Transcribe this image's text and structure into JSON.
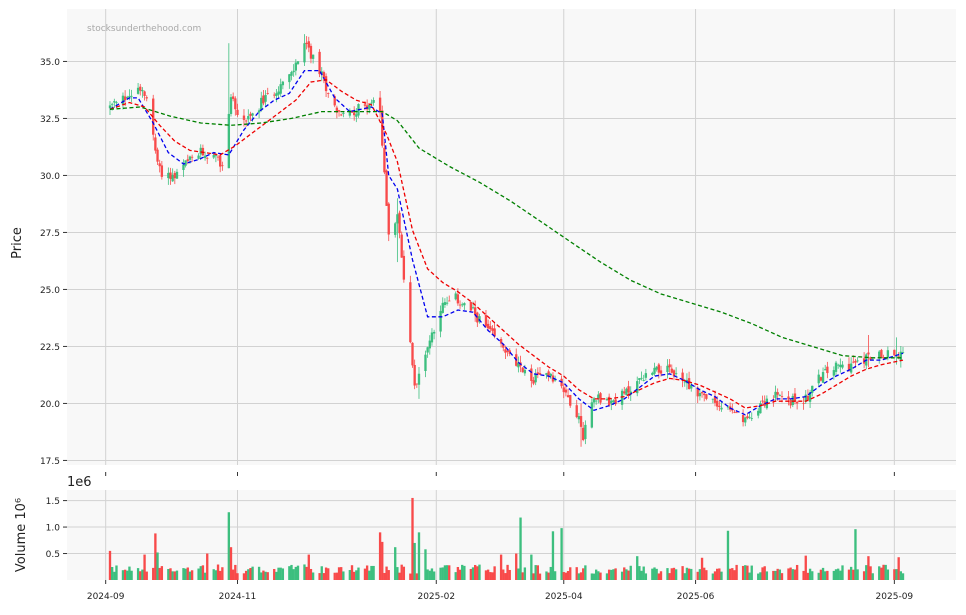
{
  "watermark": "stocksunderthehood.com",
  "colors": {
    "up": "#3dbf7f",
    "down": "#f84a4a",
    "ma_blue": "#0000ee",
    "ma_red": "#ee0000",
    "ma_green": "#008000",
    "panel_bg": "#f8f8f8",
    "grid": "#d2d2d2"
  },
  "chart_data": {
    "type": "candlestick",
    "price_panel": {
      "ylabel": "Price",
      "ylim": [
        17.3,
        37.3
      ],
      "yticks": [
        "17.5",
        "20.0",
        "22.5",
        "25.0",
        "27.5",
        "30.0",
        "32.5",
        "35.0"
      ],
      "grid": true
    },
    "volume_panel": {
      "ylabel": "Volume  10⁶",
      "multiplier_label": "1e6",
      "ylim": [
        0,
        1.7
      ],
      "yticks": [
        "0.5",
        "1.0",
        "1.5"
      ],
      "grid": true
    },
    "xticks": [
      "2024-09",
      "2024-11",
      "2025-02",
      "2025-04",
      "2025-06",
      "2025-09"
    ],
    "x_range": [
      "2024-09-03",
      "2025-09-05"
    ],
    "close_path": [
      [
        "2024-09-03",
        33.0
      ],
      [
        "2024-09-10",
        33.4
      ],
      [
        "2024-09-17",
        33.9
      ],
      [
        "2024-09-20",
        33.6
      ],
      [
        "2024-09-24",
        31.0
      ],
      [
        "2024-09-26",
        30.2
      ],
      [
        "2024-10-03",
        29.9
      ],
      [
        "2024-10-08",
        30.5
      ],
      [
        "2024-10-15",
        31.0
      ],
      [
        "2024-10-21",
        30.8
      ],
      [
        "2024-10-25",
        30.4
      ],
      [
        "2024-10-29",
        33.6
      ],
      [
        "2024-11-01",
        32.6
      ],
      [
        "2024-11-06",
        32.4
      ],
      [
        "2024-11-12",
        33.2
      ],
      [
        "2024-11-19",
        33.8
      ],
      [
        "2024-11-26",
        34.4
      ],
      [
        "2024-12-02",
        35.8
      ],
      [
        "2024-12-09",
        34.6
      ],
      [
        "2024-12-16",
        33.0
      ],
      [
        "2024-12-20",
        32.6
      ],
      [
        "2025-01-02",
        33.2
      ],
      [
        "2025-01-06",
        32.8
      ],
      [
        "2025-01-10",
        27.5
      ],
      [
        "2025-01-14",
        28.2
      ],
      [
        "2025-01-22",
        20.8
      ],
      [
        "2025-01-28",
        22.5
      ],
      [
        "2025-02-03",
        24.2
      ],
      [
        "2025-02-10",
        24.6
      ],
      [
        "2025-02-18",
        24.0
      ],
      [
        "2025-02-25",
        23.2
      ],
      [
        "2025-03-04",
        22.4
      ],
      [
        "2025-03-11",
        21.6
      ],
      [
        "2025-03-18",
        21.0
      ],
      [
        "2025-03-25",
        21.4
      ],
      [
        "2025-04-01",
        20.6
      ],
      [
        "2025-04-07",
        19.6
      ],
      [
        "2025-04-10",
        18.6
      ],
      [
        "2025-04-15",
        20.4
      ],
      [
        "2025-04-22",
        20.0
      ],
      [
        "2025-04-29",
        20.4
      ],
      [
        "2025-05-06",
        21.0
      ],
      [
        "2025-05-13",
        21.6
      ],
      [
        "2025-05-20",
        21.4
      ],
      [
        "2025-05-27",
        21.0
      ],
      [
        "2025-06-03",
        20.4
      ],
      [
        "2025-06-10",
        20.0
      ],
      [
        "2025-06-17",
        19.6
      ],
      [
        "2025-06-24",
        19.2
      ],
      [
        "2025-07-01",
        20.0
      ],
      [
        "2025-07-08",
        20.3
      ],
      [
        "2025-07-15",
        20.1
      ],
      [
        "2025-07-22",
        20.2
      ],
      [
        "2025-07-29",
        21.2
      ],
      [
        "2025-08-05",
        21.6
      ],
      [
        "2025-08-12",
        21.7
      ],
      [
        "2025-08-19",
        22.0
      ],
      [
        "2025-08-26",
        22.2
      ],
      [
        "2025-09-05",
        22.1
      ]
    ],
    "spikes": [
      {
        "date": "2024-10-28",
        "high": 35.8,
        "low": 33.0
      },
      {
        "date": "2024-12-02",
        "high": 36.2,
        "low": 34.8
      },
      {
        "date": "2025-01-14",
        "high": 29.0,
        "low": 26.2
      },
      {
        "date": "2025-01-24",
        "high": 21.6,
        "low": 20.2
      },
      {
        "date": "2025-04-09",
        "high": 20.0,
        "low": 18.1
      },
      {
        "date": "2025-08-20",
        "high": 23.0,
        "low": 21.6
      },
      {
        "date": "2025-09-02",
        "high": 22.9,
        "low": 21.7
      }
    ],
    "series": [
      {
        "name": "",
        "style": "dashed",
        "color": "#0000ee",
        "points": [
          [
            "2024-09-03",
            32.9
          ],
          [
            "2024-09-12",
            33.4
          ],
          [
            "2024-09-16",
            33.4
          ],
          [
            "2024-09-23",
            32.3
          ],
          [
            "2024-09-30",
            31.0
          ],
          [
            "2024-10-07",
            30.5
          ],
          [
            "2024-10-14",
            30.7
          ],
          [
            "2024-10-21",
            31.0
          ],
          [
            "2024-10-28",
            30.9
          ],
          [
            "2024-11-04",
            32.0
          ],
          [
            "2024-11-11",
            32.8
          ],
          [
            "2024-11-18",
            33.3
          ],
          [
            "2024-11-25",
            33.6
          ],
          [
            "2024-12-02",
            34.6
          ],
          [
            "2024-12-09",
            34.6
          ],
          [
            "2024-12-16",
            33.4
          ],
          [
            "2024-12-23",
            32.8
          ],
          [
            "2025-01-02",
            33.0
          ],
          [
            "2025-01-07",
            32.7
          ],
          [
            "2025-01-10",
            30.0
          ],
          [
            "2025-01-14",
            29.4
          ],
          [
            "2025-01-21",
            26.3
          ],
          [
            "2025-01-28",
            23.8
          ],
          [
            "2025-02-04",
            23.8
          ],
          [
            "2025-02-11",
            24.1
          ],
          [
            "2025-02-18",
            24.0
          ],
          [
            "2025-02-25",
            23.2
          ],
          [
            "2025-03-04",
            22.6
          ],
          [
            "2025-03-11",
            21.8
          ],
          [
            "2025-03-18",
            21.3
          ],
          [
            "2025-03-25",
            21.2
          ],
          [
            "2025-04-01",
            20.9
          ],
          [
            "2025-04-08",
            20.2
          ],
          [
            "2025-04-15",
            19.7
          ],
          [
            "2025-04-22",
            19.9
          ],
          [
            "2025-04-29",
            20.2
          ],
          [
            "2025-05-06",
            20.7
          ],
          [
            "2025-05-13",
            21.2
          ],
          [
            "2025-05-20",
            21.3
          ],
          [
            "2025-05-27",
            21.0
          ],
          [
            "2025-06-03",
            20.6
          ],
          [
            "2025-06-10",
            20.3
          ],
          [
            "2025-06-17",
            19.8
          ],
          [
            "2025-06-24",
            19.5
          ],
          [
            "2025-07-01",
            19.9
          ],
          [
            "2025-07-08",
            20.2
          ],
          [
            "2025-07-15",
            20.2
          ],
          [
            "2025-07-22",
            20.3
          ],
          [
            "2025-07-29",
            20.8
          ],
          [
            "2025-08-05",
            21.2
          ],
          [
            "2025-08-12",
            21.5
          ],
          [
            "2025-08-19",
            21.9
          ],
          [
            "2025-08-26",
            21.9
          ],
          [
            "2025-09-05",
            22.2
          ]
        ]
      },
      {
        "name": "",
        "style": "dashed",
        "color": "#ee0000",
        "points": [
          [
            "2024-09-03",
            32.9
          ],
          [
            "2024-09-12",
            33.2
          ],
          [
            "2024-09-19",
            33.0
          ],
          [
            "2024-09-26",
            32.2
          ],
          [
            "2024-10-03",
            31.5
          ],
          [
            "2024-10-10",
            31.1
          ],
          [
            "2024-10-17",
            31.0
          ],
          [
            "2024-10-24",
            30.9
          ],
          [
            "2024-10-31",
            31.3
          ],
          [
            "2024-11-07",
            31.8
          ],
          [
            "2024-11-14",
            32.3
          ],
          [
            "2024-11-21",
            32.8
          ],
          [
            "2024-11-28",
            33.3
          ],
          [
            "2024-12-05",
            34.1
          ],
          [
            "2024-12-12",
            34.2
          ],
          [
            "2024-12-19",
            33.7
          ],
          [
            "2024-12-26",
            33.3
          ],
          [
            "2025-01-02",
            33.1
          ],
          [
            "2025-01-09",
            31.8
          ],
          [
            "2025-01-14",
            30.6
          ],
          [
            "2025-01-21",
            27.6
          ],
          [
            "2025-01-28",
            25.9
          ],
          [
            "2025-02-04",
            25.3
          ],
          [
            "2025-02-11",
            24.9
          ],
          [
            "2025-02-18",
            24.4
          ],
          [
            "2025-02-25",
            23.8
          ],
          [
            "2025-03-04",
            23.2
          ],
          [
            "2025-03-11",
            22.6
          ],
          [
            "2025-03-18",
            22.1
          ],
          [
            "2025-03-25",
            21.6
          ],
          [
            "2025-04-01",
            21.2
          ],
          [
            "2025-04-08",
            20.6
          ],
          [
            "2025-04-15",
            20.2
          ],
          [
            "2025-04-22",
            20.2
          ],
          [
            "2025-04-29",
            20.3
          ],
          [
            "2025-05-06",
            20.6
          ],
          [
            "2025-05-13",
            20.9
          ],
          [
            "2025-05-20",
            21.1
          ],
          [
            "2025-05-27",
            21.0
          ],
          [
            "2025-06-03",
            20.8
          ],
          [
            "2025-06-10",
            20.5
          ],
          [
            "2025-06-17",
            20.2
          ],
          [
            "2025-06-24",
            19.8
          ],
          [
            "2025-07-01",
            19.9
          ],
          [
            "2025-07-08",
            20.1
          ],
          [
            "2025-07-15",
            20.1
          ],
          [
            "2025-07-22",
            20.1
          ],
          [
            "2025-07-29",
            20.4
          ],
          [
            "2025-08-05",
            20.8
          ],
          [
            "2025-08-12",
            21.2
          ],
          [
            "2025-08-19",
            21.5
          ],
          [
            "2025-08-26",
            21.7
          ],
          [
            "2025-09-05",
            21.9
          ]
        ]
      },
      {
        "name": "",
        "style": "dashed",
        "color": "#008000",
        "points": [
          [
            "2024-09-03",
            32.9
          ],
          [
            "2024-09-17",
            33.0
          ],
          [
            "2024-10-01",
            32.6
          ],
          [
            "2024-10-15",
            32.3
          ],
          [
            "2024-10-29",
            32.2
          ],
          [
            "2024-11-12",
            32.3
          ],
          [
            "2024-11-26",
            32.5
          ],
          [
            "2024-12-10",
            32.8
          ],
          [
            "2024-12-24",
            32.8
          ],
          [
            "2025-01-07",
            32.8
          ],
          [
            "2025-01-14",
            32.4
          ],
          [
            "2025-01-24",
            31.2
          ],
          [
            "2025-02-07",
            30.4
          ],
          [
            "2025-02-21",
            29.7
          ],
          [
            "2025-03-07",
            28.9
          ],
          [
            "2025-03-21",
            28.0
          ],
          [
            "2025-04-04",
            27.1
          ],
          [
            "2025-04-18",
            26.2
          ],
          [
            "2025-05-02",
            25.4
          ],
          [
            "2025-05-16",
            24.8
          ],
          [
            "2025-05-30",
            24.4
          ],
          [
            "2025-06-13",
            24.0
          ],
          [
            "2025-06-27",
            23.5
          ],
          [
            "2025-07-11",
            22.9
          ],
          [
            "2025-07-25",
            22.5
          ],
          [
            "2025-08-08",
            22.1
          ],
          [
            "2025-08-22",
            22.0
          ],
          [
            "2025-09-05",
            22.0
          ]
        ]
      }
    ],
    "volume": {
      "base": 0.22,
      "spikes": [
        {
          "date": "2024-09-03",
          "value": 0.55,
          "dir": "down"
        },
        {
          "date": "2024-09-19",
          "value": 0.48,
          "dir": "down"
        },
        {
          "date": "2024-09-24",
          "value": 0.88,
          "dir": "down"
        },
        {
          "date": "2024-09-25",
          "value": 0.52,
          "dir": "up"
        },
        {
          "date": "2024-10-18",
          "value": 0.5,
          "dir": "down"
        },
        {
          "date": "2024-10-28",
          "value": 1.28,
          "dir": "up"
        },
        {
          "date": "2024-10-29",
          "value": 0.62,
          "dir": "down"
        },
        {
          "date": "2024-12-04",
          "value": 0.48,
          "dir": "down"
        },
        {
          "date": "2025-01-06",
          "value": 0.9,
          "dir": "down"
        },
        {
          "date": "2025-01-07",
          "value": 0.72,
          "dir": "down"
        },
        {
          "date": "2025-01-13",
          "value": 0.62,
          "dir": "up"
        },
        {
          "date": "2025-01-21",
          "value": 1.55,
          "dir": "down"
        },
        {
          "date": "2025-01-22",
          "value": 0.7,
          "dir": "up"
        },
        {
          "date": "2025-01-24",
          "value": 0.9,
          "dir": "up"
        },
        {
          "date": "2025-01-27",
          "value": 0.58,
          "dir": "up"
        },
        {
          "date": "2025-03-03",
          "value": 0.48,
          "dir": "down"
        },
        {
          "date": "2025-03-10",
          "value": 0.5,
          "dir": "down"
        },
        {
          "date": "2025-03-12",
          "value": 1.18,
          "dir": "up"
        },
        {
          "date": "2025-03-17",
          "value": 0.48,
          "dir": "up"
        },
        {
          "date": "2025-03-27",
          "value": 0.92,
          "dir": "up"
        },
        {
          "date": "2025-03-31",
          "value": 0.98,
          "dir": "up"
        },
        {
          "date": "2025-05-05",
          "value": 0.45,
          "dir": "up"
        },
        {
          "date": "2025-06-04",
          "value": 0.42,
          "dir": "down"
        },
        {
          "date": "2025-06-16",
          "value": 0.93,
          "dir": "up"
        },
        {
          "date": "2025-07-22",
          "value": 0.46,
          "dir": "down"
        },
        {
          "date": "2025-08-14",
          "value": 0.96,
          "dir": "up"
        },
        {
          "date": "2025-08-20",
          "value": 0.45,
          "dir": "down"
        },
        {
          "date": "2025-09-03",
          "value": 0.43,
          "dir": "down"
        }
      ]
    }
  }
}
